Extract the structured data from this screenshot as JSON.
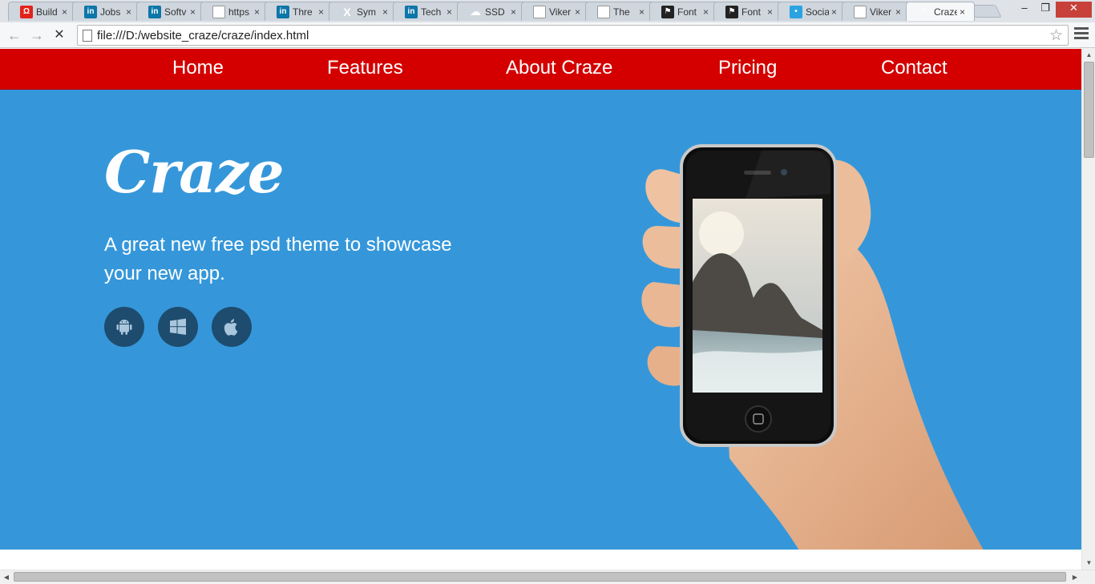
{
  "browser": {
    "tabs": [
      {
        "title": "Build",
        "favicon": "red-icon",
        "active": false
      },
      {
        "title": "Jobs",
        "favicon": "linkedin-icon",
        "active": false
      },
      {
        "title": "Softv",
        "favicon": "linkedin-icon",
        "active": false
      },
      {
        "title": "https",
        "favicon": "page-icon",
        "active": false
      },
      {
        "title": "Thre",
        "favicon": "linkedin-icon",
        "active": false
      },
      {
        "title": "Sym",
        "favicon": "x-icon",
        "active": false
      },
      {
        "title": "Tech",
        "favicon": "linkedin-icon",
        "active": false
      },
      {
        "title": "SSD",
        "favicon": "cloud-icon",
        "active": false
      },
      {
        "title": "Viker",
        "favicon": "page-icon",
        "active": false
      },
      {
        "title": "The",
        "favicon": "page-icon",
        "active": false
      },
      {
        "title": "Font",
        "favicon": "flag-icon",
        "active": false
      },
      {
        "title": "Font",
        "favicon": "flag-icon",
        "active": false
      },
      {
        "title": "Socia",
        "favicon": "social-icon",
        "active": false
      },
      {
        "title": "Viker",
        "favicon": "page-icon",
        "active": false
      },
      {
        "title": "Craze",
        "favicon": "loading-icon",
        "active": true
      }
    ],
    "tab_close_glyph": "×",
    "window_controls": {
      "minimize": "–",
      "restore": "❐",
      "close": "✕"
    },
    "back_glyph": "←",
    "forward_glyph": "→",
    "stop_glyph": "✕",
    "url": "file:///D:/website_craze/craze/index.html",
    "star_glyph": "☆"
  },
  "nav": {
    "items": [
      "Home",
      "Features",
      "About Craze",
      "Pricing",
      "Contact"
    ]
  },
  "hero": {
    "logo": "Craze",
    "tagline": "A great new free psd theme to showcase your new app.",
    "store_buttons": [
      "android-icon",
      "windows-icon",
      "apple-icon"
    ],
    "colors": {
      "nav": "#d40000",
      "hero": "#3597da",
      "store_button": "#1e4c6e"
    }
  }
}
